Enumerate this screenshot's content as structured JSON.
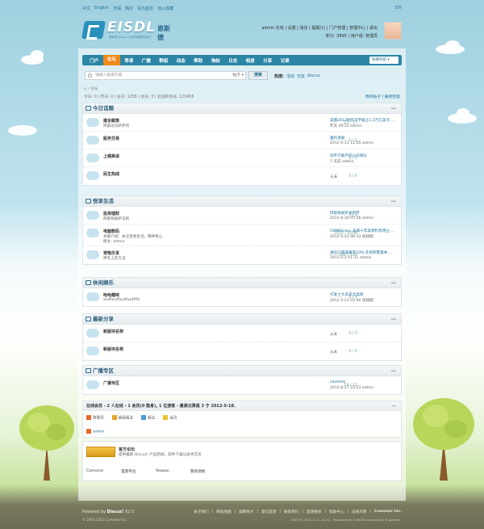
{
  "topbar": {
    "links": [
      "中文",
      "English",
      "日语",
      "韩文",
      "设为首页",
      "加入收藏"
    ],
    "right": "DIY"
  },
  "logo": {
    "text": "EISDL",
    "cn": "恩斯德",
    "sub": "恩斯德 Discuz 论坛风格模板设计"
  },
  "user": {
    "line1": "admin 在线 | 设置 | 消息 | 提醒(1) | 门户管理 | 管理中心 | 退出",
    "line2": "积分: 3895 | 用户组: 管理员"
  },
  "nav": {
    "items": [
      "门户",
      "论坛",
      "导读",
      "广播",
      "群组",
      "动态",
      "帮助",
      "淘帖",
      "日志",
      "相册",
      "分享",
      "记录"
    ],
    "active": 1,
    "quick": "快捷导航"
  },
  "search": {
    "placeholder": "请输入搜索内容",
    "type": "帖子",
    "button": "搜索",
    "hot_label": "热搜:",
    "hot": [
      "活动",
      "交友",
      "discuz"
    ]
  },
  "crumb": "⌂ › 论坛",
  "stats": "今日: 0 | 昨日: 0 | 帖子: 1256 | 会员: 3 | 欢迎新会员: 123456",
  "stats_right": "我的帖子 | 最新回复",
  "sections": [
    {
      "title": "今日话题",
      "forums": [
        {
          "name": "建言献策",
          "desc": "阿斯达法萨萨的",
          "count": "23 / 27",
          "last": "美国2012财年升字截止1.2万亿美元 ...",
          "last_info": "昨天 09:25 admin"
        },
        {
          "name": "股务交易",
          "desc": "",
          "count": "1 / 1",
          "last": "童托发展",
          "last_info": "2012-6-11 12:45 admin"
        },
        {
          "name": "上镜美谈",
          "desc": "",
          "count": "1 / 2",
          "last": "润平只能严控公司增长",
          "last_info": "7 天前 admin"
        },
        {
          "name": "民生热线",
          "desc": "",
          "count": "0 / 0",
          "never": "从未"
        }
      ]
    },
    {
      "title": "悦享生活",
      "forums": [
        {
          "name": "投资理财",
          "desc": "阿斯顿发萨法的",
          "count": "3 / 6",
          "last": "阿斯顿发萨发萨芳",
          "last_info": "2012-6-30 05:56 admin"
        },
        {
          "name": "电脑数码",
          "desc": "本版介绍：关注百姓生活，精神民心",
          "desc2": "版主: admin",
          "count": "1035 / 1036",
          "last": "CNNMoney: 未来十年美债利息增占 ...",
          "last_info": "2012-5-22 06:33 张翔翔"
        },
        {
          "name": "宠物乐享",
          "desc": "伊东上的方法",
          "count": "161 / 161",
          "last": "通出口增速重有10% 外贸积累基本 ...",
          "last_info": "2012-5-2 01:31 admin"
        }
      ]
    },
    {
      "title": "休闲娱乐",
      "forums": [
        {
          "name": "哈哈趣味",
          "desc": "asdfasdfasdfasdfffd",
          "count": "1 / 1",
          "last": "打发士大夫是丈选绑",
          "last_info": "2012-5-23 02:00 张翔翔"
        }
      ]
    },
    {
      "title": "最新分享",
      "forums": [
        {
          "name": "新版块名称",
          "desc": "",
          "count": "0 / 0",
          "never": "从未"
        },
        {
          "name": "新版块名称",
          "desc": "",
          "count": "0 / 0",
          "never": "从未"
        }
      ]
    },
    {
      "title": "广播专区",
      "forums": [
        {
          "name": "广播专区",
          "desc": "",
          "count": "19 / 22",
          "last": "sdafsffer",
          "last_info": "2012-6-27 10:53 admin"
        }
      ]
    }
  ],
  "online": {
    "title": "在线会员 - 2 人在线 - 1 会员(0 隐身), 1 位游客 - 最高记录是 3 于 2012-5-18.",
    "toggle": "—",
    "legend": [
      "管理员",
      "超级版主",
      "版主",
      "会员"
    ],
    "members": [
      "admin"
    ]
  },
  "links": {
    "title": "官方论坛",
    "desc": "提供最新 Discuz! 产品新闻、软件下载与技术交流",
    "items": [
      "Comsenz",
      "漫游平台",
      "Yeswan",
      "我的领地"
    ]
  },
  "footer": {
    "powered": "Powered by",
    "brand": "Discuz!",
    "ver": "X2.5",
    "copy": "© 2001-2012 Comsenz Inc.",
    "links": [
      "关于我们",
      "网站地图",
      "诚聘英才",
      "意见反馈",
      "联系我们",
      "友情链接",
      "帮助中心",
      "法律声明",
      "Comsenz Inc."
    ],
    "gmt": "GMT+8, 2012-7-11 10:22 , Processed in 0.061024 second(s), 8 queries ."
  },
  "colors": {
    "nav": "#2b86a6",
    "active": "#f08a1c",
    "link": "#1f6f98"
  }
}
